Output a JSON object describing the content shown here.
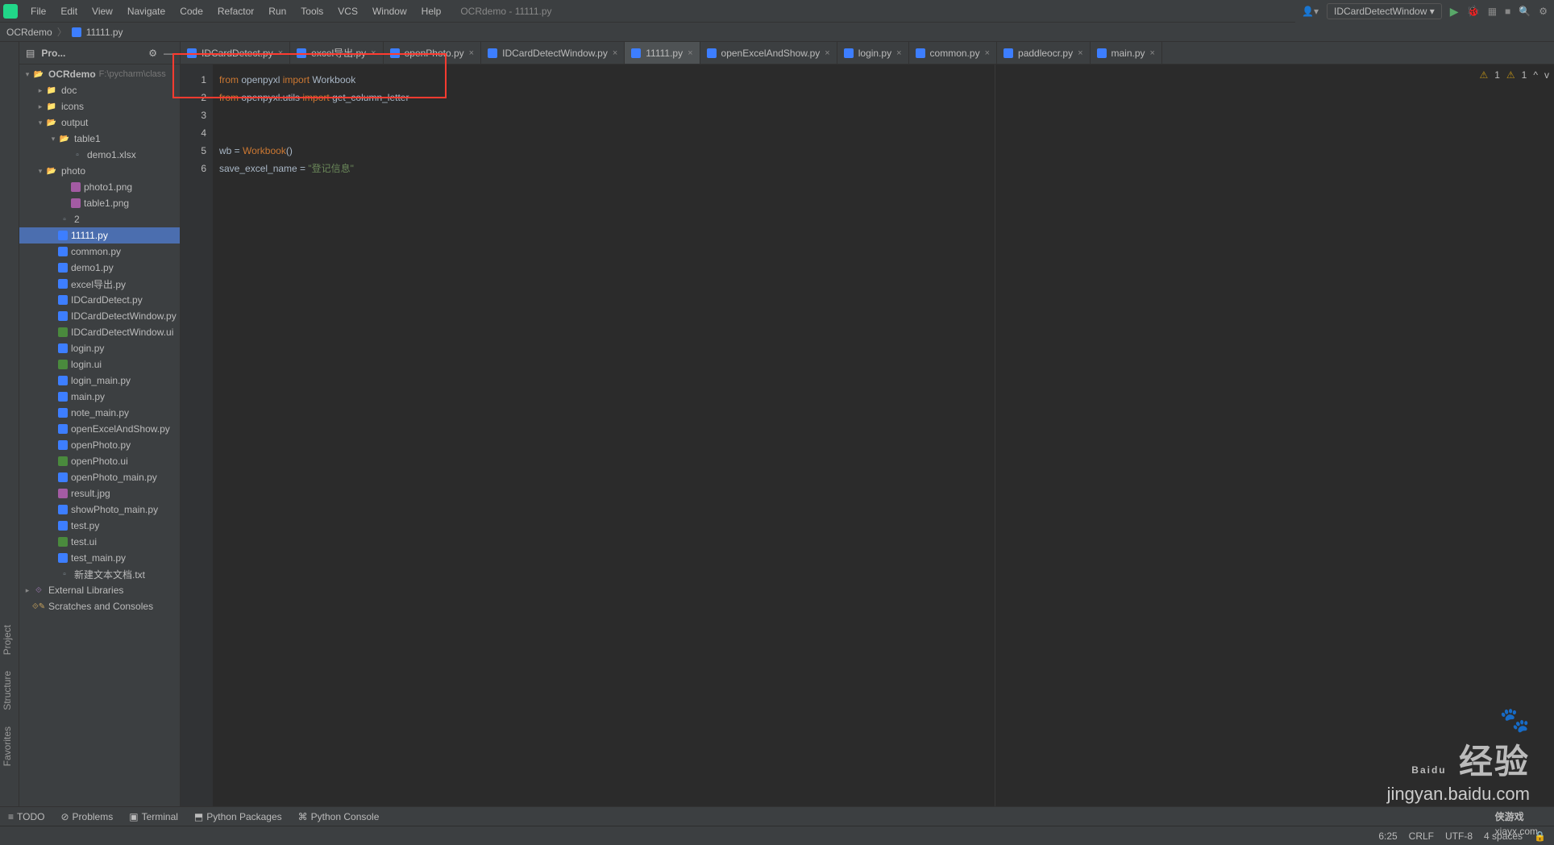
{
  "window": {
    "title": "OCRdemo - 11111.py"
  },
  "menu": [
    "File",
    "Edit",
    "View",
    "Navigate",
    "Code",
    "Refactor",
    "Run",
    "Tools",
    "VCS",
    "Window",
    "Help"
  ],
  "breadcrumb": {
    "root": "OCRdemo",
    "file": "11111.py"
  },
  "panel": {
    "title": "Pro...",
    "hide": "—",
    "gear": "⚙",
    "collapse": "▣"
  },
  "project": {
    "root": "OCRdemo",
    "root_path": "F:\\pycharm\\class",
    "doc": "doc",
    "icons": "icons",
    "output": "output",
    "table1": "table1",
    "demo1xlsx": "demo1.xlsx",
    "photo": "photo",
    "photo1": "photo1.png",
    "table1png": "table1.png",
    "two": "2",
    "f_11111": "11111.py",
    "common": "common.py",
    "demo1": "demo1.py",
    "excel": "excel导出.py",
    "idcard": "IDCardDetect.py",
    "idcardwin": "IDCardDetectWindow.py",
    "idcardwinui": "IDCardDetectWindow.ui",
    "login": "login.py",
    "loginui": "login.ui",
    "loginmain": "login_main.py",
    "main": "main.py",
    "notemain": "note_main.py",
    "openexcel": "openExcelAndShow.py",
    "openphoto": "openPhoto.py",
    "openphotoui": "openPhoto.ui",
    "openphotomain": "openPhoto_main.py",
    "result": "result.jpg",
    "showphoto": "showPhoto_main.py",
    "test": "test.py",
    "testui": "test.ui",
    "testmain": "test_main.py",
    "newtxt": "新建文本文档.txt",
    "extlib": "External Libraries",
    "scratches": "Scratches and Consoles"
  },
  "tabs": [
    "IDCardDetect.py",
    "excel导出.py",
    "openPhoto.py",
    "IDCardDetectWindow.py",
    "11111.py",
    "openExcelAndShow.py",
    "login.py",
    "common.py",
    "paddleocr.py",
    "main.py"
  ],
  "active_tab": 4,
  "run_config": "IDCardDetectWindow",
  "code": {
    "l1_from": "from ",
    "l1_mod": "openpyxl ",
    "l1_import": "import ",
    "l1_name": "Workbook",
    "l2_from": "from ",
    "l2_mod": "openpyxl.utils ",
    "l2_import": "import ",
    "l2_name": "get_column_letter",
    "l5_var": "wb = ",
    "l5_cls": "Workbook",
    "l5_p": "()",
    "l6_var": "save_excel_name = ",
    "l6_str": "\"登记信息\""
  },
  "line_numbers": [
    "1",
    "2",
    "3",
    "4",
    "5",
    "6"
  ],
  "inspections": {
    "warn1": "1",
    "warn2": "1",
    "chev": "^",
    "v": "v"
  },
  "left_tabs": {
    "project": "Project",
    "structure": "Structure",
    "favorites": "Favorites"
  },
  "bottom": {
    "todo": "TODO",
    "problems": "Problems",
    "terminal": "Terminal",
    "pypkg": "Python Packages",
    "pyconsole": "Python Console"
  },
  "status": {
    "pos": "6:25",
    "crlf": "CRLF",
    "enc": "UTF-8",
    "indent": "4 spaces"
  },
  "watermark": {
    "brand": "Baidu",
    "cn": "经验",
    "url": "jingyan.baidu.com",
    "site": "xiayx.com",
    "game": "侠游戏"
  }
}
